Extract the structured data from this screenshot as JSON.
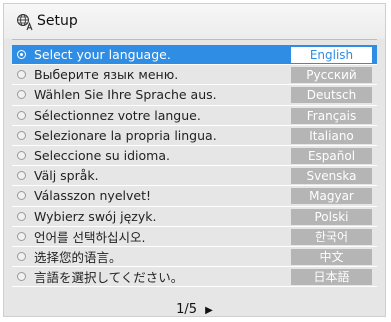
{
  "window": {
    "title": "Setup",
    "icon": "globe-language-icon"
  },
  "colors": {
    "accent": "#2f8de4",
    "button_gray": "#b5b5b5",
    "panel": "#e6e6e6"
  },
  "languages": [
    {
      "prompt": "Select your language.",
      "label": "English",
      "selected": true
    },
    {
      "prompt": "Выберите язык меню.",
      "label": "Русский",
      "selected": false
    },
    {
      "prompt": "Wählen Sie Ihre Sprache aus.",
      "label": "Deutsch",
      "selected": false
    },
    {
      "prompt": "Sélectionnez votre langue.",
      "label": "Français",
      "selected": false
    },
    {
      "prompt": "Selezionare la propria lingua.",
      "label": "Italiano",
      "selected": false
    },
    {
      "prompt": "Seleccione su idioma.",
      "label": "Español",
      "selected": false
    },
    {
      "prompt": "Välj språk.",
      "label": "Svenska",
      "selected": false
    },
    {
      "prompt": "Válasszon nyelvet!",
      "label": "Magyar",
      "selected": false
    },
    {
      "prompt": "Wybierz swój język.",
      "label": "Polski",
      "selected": false
    },
    {
      "prompt": "언어를 선택하십시오.",
      "label": "한국어",
      "selected": false
    },
    {
      "prompt": "选择您的语言。",
      "label": "中文",
      "selected": false
    },
    {
      "prompt": "言語を選択してください。",
      "label": "日本語",
      "selected": false
    }
  ],
  "pagination": {
    "text": "1/5",
    "next_icon": "play-right-icon"
  }
}
